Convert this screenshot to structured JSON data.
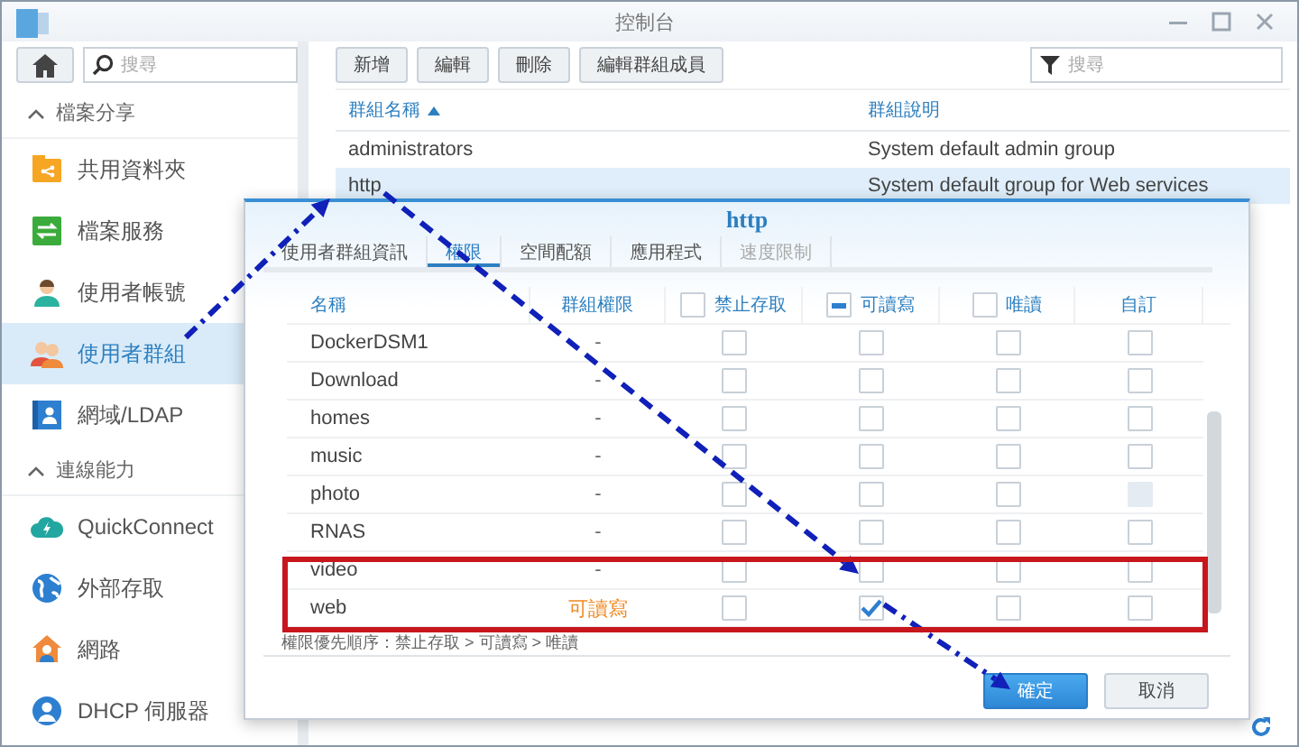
{
  "window": {
    "title": "控制台"
  },
  "sidebar": {
    "search": {
      "placeholder": "搜尋"
    },
    "sections": [
      {
        "label": "檔案分享",
        "expanded": true,
        "items": [
          {
            "label": "共用資料夾",
            "selected": false
          },
          {
            "label": "檔案服務",
            "selected": false
          },
          {
            "label": "使用者帳號",
            "selected": false
          },
          {
            "label": "使用者群組",
            "selected": true
          },
          {
            "label": "網域/LDAP",
            "selected": false
          }
        ]
      },
      {
        "label": "連線能力",
        "expanded": true,
        "items": [
          {
            "label": "QuickConnect",
            "selected": false
          },
          {
            "label": "外部存取",
            "selected": false
          },
          {
            "label": "網路",
            "selected": false
          },
          {
            "label": "DHCP 伺服器",
            "selected": false
          }
        ]
      }
    ]
  },
  "toolbar": {
    "buttons": [
      "新增",
      "編輯",
      "刪除",
      "編輯群組成員"
    ],
    "filter": {
      "placeholder": "搜尋"
    }
  },
  "table": {
    "columns": [
      {
        "label": "群組名稱",
        "sorted": true
      },
      {
        "label": "群組說明",
        "sorted": false
      }
    ],
    "rows": [
      {
        "cells": [
          "administrators",
          "System default admin group"
        ],
        "selected": false
      },
      {
        "cells": [
          "http",
          "System default group for Web services"
        ],
        "selected": true
      }
    ]
  },
  "dialog": {
    "title": "http",
    "tabs": [
      {
        "label": "使用者群組資訊",
        "selected": false,
        "disabled": false
      },
      {
        "label": "權限",
        "selected": true,
        "disabled": false
      },
      {
        "label": "空間配額",
        "selected": false,
        "disabled": false
      },
      {
        "label": "應用程式",
        "selected": false,
        "disabled": false
      },
      {
        "label": "速度限制",
        "selected": false,
        "disabled": true
      }
    ],
    "columns": [
      {
        "label": "名稱"
      },
      {
        "label": "群組權限"
      },
      {
        "label": "禁止存取",
        "check_all": {
          "partial": false
        }
      },
      {
        "label": "可讀寫",
        "check_all": {
          "partial": true
        }
      },
      {
        "label": "唯讀",
        "check_all": {
          "partial": false
        }
      },
      {
        "label": "自訂"
      }
    ],
    "rows": [
      {
        "name": "DockerDSM1",
        "permission": "-",
        "checks": [
          {
            "checked": false,
            "disabled": false
          },
          {
            "checked": false,
            "disabled": false
          },
          {
            "checked": false,
            "disabled": false
          },
          {
            "checked": false,
            "disabled": false
          }
        ]
      },
      {
        "name": "Download",
        "permission": "-",
        "checks": [
          {
            "checked": false,
            "disabled": false
          },
          {
            "checked": false,
            "disabled": false
          },
          {
            "checked": false,
            "disabled": false
          },
          {
            "checked": false,
            "disabled": false
          }
        ]
      },
      {
        "name": "homes",
        "permission": "-",
        "checks": [
          {
            "checked": false,
            "disabled": false
          },
          {
            "checked": false,
            "disabled": false
          },
          {
            "checked": false,
            "disabled": false
          },
          {
            "checked": false,
            "disabled": false
          }
        ]
      },
      {
        "name": "music",
        "permission": "-",
        "checks": [
          {
            "checked": false,
            "disabled": false
          },
          {
            "checked": false,
            "disabled": false
          },
          {
            "checked": false,
            "disabled": false
          },
          {
            "checked": false,
            "disabled": false
          }
        ]
      },
      {
        "name": "photo",
        "permission": "-",
        "checks": [
          {
            "checked": false,
            "disabled": false
          },
          {
            "checked": false,
            "disabled": false
          },
          {
            "checked": false,
            "disabled": false
          },
          {
            "checked": false,
            "disabled": true
          }
        ]
      },
      {
        "name": "RNAS",
        "permission": "-",
        "checks": [
          {
            "checked": false,
            "disabled": false
          },
          {
            "checked": false,
            "disabled": false
          },
          {
            "checked": false,
            "disabled": false
          },
          {
            "checked": false,
            "disabled": false
          }
        ]
      },
      {
        "name": "video",
        "permission": "-",
        "checks": [
          {
            "checked": false,
            "disabled": false
          },
          {
            "checked": false,
            "disabled": false
          },
          {
            "checked": false,
            "disabled": false
          },
          {
            "checked": false,
            "disabled": false
          }
        ]
      },
      {
        "name": "web",
        "permission": "可讀寫",
        "checks": [
          {
            "checked": false,
            "disabled": false
          },
          {
            "checked": true,
            "disabled": false
          },
          {
            "checked": false,
            "disabled": false
          },
          {
            "checked": false,
            "disabled": false
          }
        ]
      }
    ],
    "note": "權限優先順序：禁止存取 > 可讀寫 > 唯讀",
    "buttons": [
      {
        "label": "確定",
        "kind": "primary"
      },
      {
        "label": "取消",
        "kind": "secondary"
      }
    ]
  },
  "annotations": [
    {
      "kind": "arrow"
    },
    {
      "kind": "arrow"
    },
    {
      "kind": "arrow"
    },
    {
      "kind": "box"
    }
  ]
}
